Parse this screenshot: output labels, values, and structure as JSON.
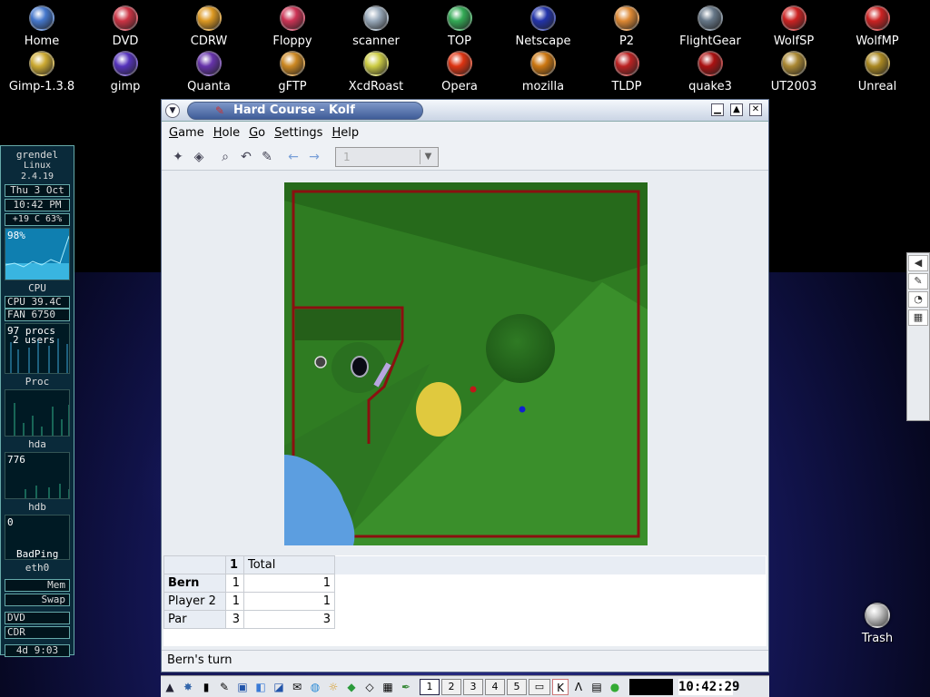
{
  "desktop": {
    "icons_row1": [
      {
        "label": "Home",
        "color": "#4477cc"
      },
      {
        "label": "DVD",
        "color": "#cc3344"
      },
      {
        "label": "CDRW",
        "color": "#dd9922"
      },
      {
        "label": "Floppy",
        "color": "#cc3355"
      },
      {
        "label": "scanner",
        "color": "#99aabb"
      },
      {
        "label": "TOP",
        "color": "#33aa55"
      },
      {
        "label": "Netscape",
        "color": "#2233aa"
      },
      {
        "label": "P2",
        "color": "#dd8833"
      },
      {
        "label": "FlightGear",
        "color": "#667788"
      },
      {
        "label": "WolfSP",
        "color": "#cc2222"
      },
      {
        "label": "WolfMP",
        "color": "#cc2222"
      }
    ],
    "icons_row2": [
      {
        "label": "Gimp-1.3.8",
        "color": "#ccaa33"
      },
      {
        "label": "gimp",
        "color": "#5533bb"
      },
      {
        "label": "Quanta",
        "color": "#6633aa"
      },
      {
        "label": "gFTP",
        "color": "#cc8822"
      },
      {
        "label": "XcdRoast",
        "color": "#cccc44"
      },
      {
        "label": "Opera",
        "color": "#dd3311"
      },
      {
        "label": "mozilla",
        "color": "#cc7711"
      },
      {
        "label": "TLDP",
        "color": "#bb2222"
      },
      {
        "label": "quake3",
        "color": "#aa1111"
      },
      {
        "label": "UT2003",
        "color": "#aa8833"
      },
      {
        "label": "Unreal",
        "color": "#aa8822"
      }
    ],
    "trash_label": "Trash"
  },
  "gkrellm": {
    "hostname": "grendel",
    "kernel": "Linux 2.4.19",
    "date": "Thu  3 Oct",
    "time": "10:42 PM",
    "sensor": "+19 C 63%",
    "cpu_percent": "98%",
    "cpu_label": "CPU",
    "cpu_temp": "CPU  39.4C",
    "fan": "FAN  6750",
    "procs": "97 procs",
    "users": "2 users",
    "proc_label": "Proc",
    "hda_label": "hda",
    "hdb_value": "776",
    "hdb_label": "hdb",
    "ping_value": "0",
    "ping_label": "BadPing",
    "eth_label": "eth0",
    "mem_label": "Mem",
    "swap_label": "Swap",
    "dvd_label": "DVD",
    "cdr_label": "CDR",
    "uptime": "4d  9:03"
  },
  "window": {
    "title": "Hard Course - Kolf",
    "menu": [
      {
        "label": "Game",
        "accel": "G",
        "rest": "ame"
      },
      {
        "label": "Hole",
        "accel": "H",
        "rest": "ole"
      },
      {
        "label": "Go",
        "accel": "G",
        "rest": "o"
      },
      {
        "label": "Settings",
        "accel": "S",
        "rest": "ettings"
      },
      {
        "label": "Help",
        "accel": "H",
        "rest": "elp"
      }
    ],
    "hole_combo": "1",
    "score": {
      "headers": [
        "1",
        "Total"
      ],
      "rows": [
        {
          "name": "Bern",
          "hole": "1",
          "total": "1"
        },
        {
          "name": "Player 2",
          "hole": "1",
          "total": "1"
        },
        {
          "name": "Par",
          "hole": "3",
          "total": "3"
        }
      ]
    },
    "status": "Bern's turn"
  },
  "taskbar": {
    "desktops": [
      "1",
      "2",
      "3",
      "4",
      "5"
    ],
    "active_desktop": "1",
    "clock": "10:42:29"
  }
}
